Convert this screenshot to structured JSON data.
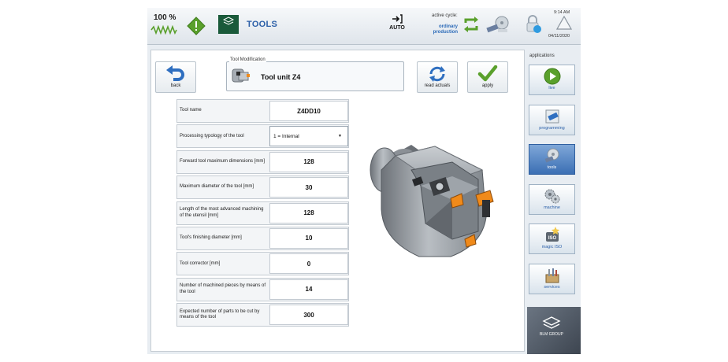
{
  "header": {
    "percentage": "100 %",
    "title": "TOOLS",
    "brand_logo_text": "BLM GROUP",
    "mode": "AUTO",
    "cycle_label": "active cycle:",
    "cycle_value_1": "ordinary",
    "cycle_value_2": "production",
    "time": "9:14 AM",
    "date": "04/11/2020"
  },
  "toolbar": {
    "back_label": "back",
    "read_actuals_label": "read actuals",
    "apply_label": "apply",
    "tool_modification_label": "Tool Modification",
    "tool_name": "Tool unit Z4"
  },
  "form": {
    "rows": [
      {
        "label": "Tool name",
        "value": "Z4DD10"
      },
      {
        "label": "Processing typology of the tool",
        "value": "1 = Internal"
      },
      {
        "label": "Forward tool maximum dimensions [mm]",
        "value": "128"
      },
      {
        "label": "Maximum diameter of the tool [mm]",
        "value": "30"
      },
      {
        "label": "Length of the most advanced machining of the utensil [mm]",
        "value": "128"
      },
      {
        "label": "Tool's finishing diameter [mm]",
        "value": "10"
      },
      {
        "label": "Tool corrector [mm]",
        "value": "0"
      },
      {
        "label": "Number of machined pieces by means of the tool",
        "value": "14"
      },
      {
        "label": "Expected number of parts to be cut by means of the tool",
        "value": "300"
      }
    ]
  },
  "sidebar": {
    "title": "applications",
    "items": [
      {
        "label": "live"
      },
      {
        "label": "programming"
      },
      {
        "label": "tools"
      },
      {
        "label": "machine"
      },
      {
        "label": "magic ISO"
      },
      {
        "label": "services"
      }
    ],
    "bottom_label": "BLM GROUP"
  },
  "colors": {
    "accent": "#2b5fa8",
    "green": "#5aa02c",
    "orange": "#f08a1a",
    "active_sidebar": "#3b6fb4"
  }
}
